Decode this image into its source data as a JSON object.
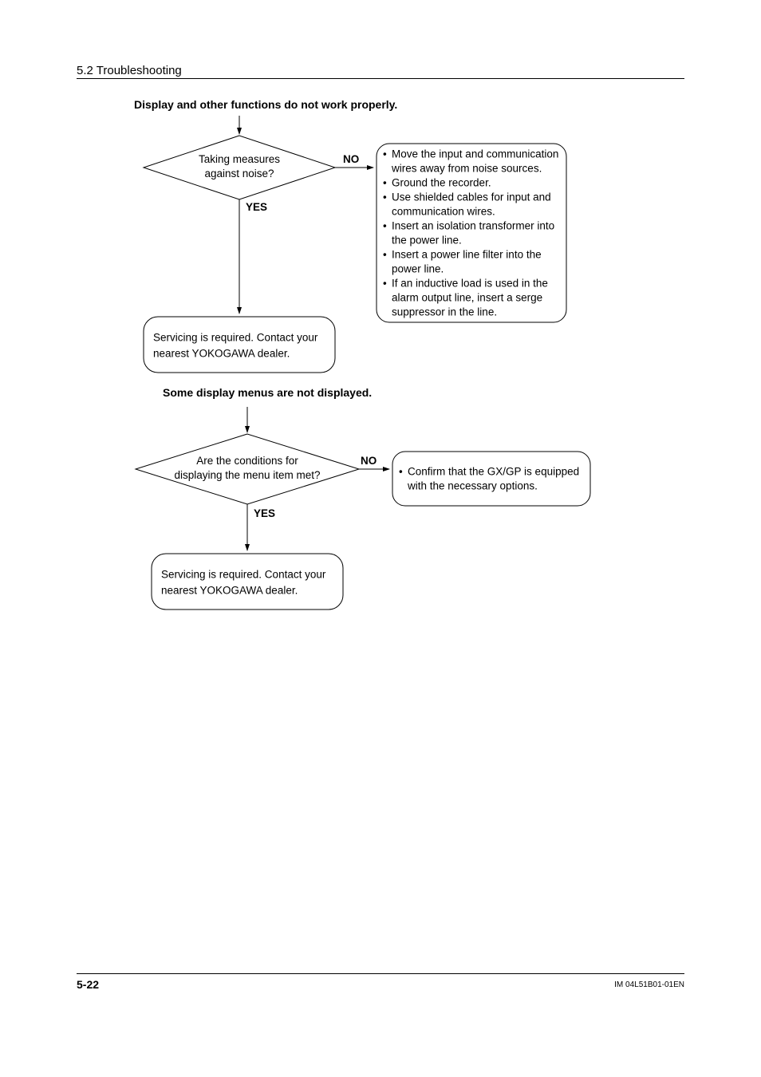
{
  "header": {
    "section": "5.2  Troubleshooting"
  },
  "flow1": {
    "title": "Display and other functions do not work properly.",
    "decision": {
      "line1": "Taking measures",
      "line2": "against noise?"
    },
    "yes": "YES",
    "no": "NO",
    "terminal": {
      "line1": "Servicing is required. Contact your",
      "line2": "nearest YOKOGAWA dealer."
    },
    "bullets": [
      {
        "l1": "Move the input and communication",
        "l2": "wires away from noise sources."
      },
      {
        "l1": "Ground the recorder.",
        "l2": ""
      },
      {
        "l1": "Use shielded cables for input and",
        "l2": "communication wires."
      },
      {
        "l1": "Insert an isolation transformer into",
        "l2": "the power line."
      },
      {
        "l1": "Insert a power line filter into the",
        "l2": "power line."
      },
      {
        "l1": "If an inductive load is used in the",
        "l2": "alarm output line, insert a serge",
        "l3": "suppressor in the line."
      }
    ]
  },
  "flow2": {
    "title": "Some display menus are not displayed.",
    "decision": {
      "line1": "Are the conditions for",
      "line2": "displaying the menu item met?"
    },
    "yes": "YES",
    "no": "NO",
    "terminal": {
      "line1": "Servicing is required. Contact your",
      "line2": "nearest YOKOGAWA dealer."
    },
    "bullets": [
      {
        "l1": "Confirm that the GX/GP is equipped",
        "l2": "with the necessary options."
      }
    ]
  },
  "footer": {
    "page": "5-22",
    "doc": "IM 04L51B01-01EN"
  }
}
